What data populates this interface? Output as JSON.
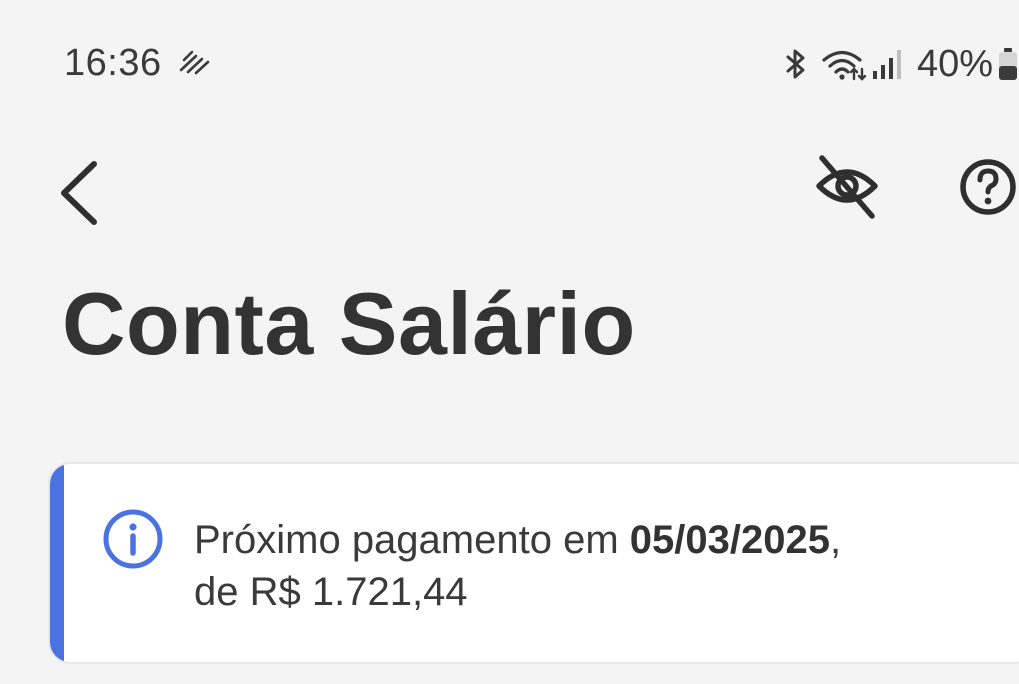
{
  "status_bar": {
    "time": "16:36",
    "battery": "40%",
    "icons": [
      "sync-icon",
      "bluetooth-icon",
      "wifi-icon",
      "signal-icon",
      "battery-icon"
    ]
  },
  "toolbar": {
    "back_icon": "chevron-left-icon",
    "visibility_icon": "eye-off-icon",
    "help_icon": "question-circle-icon"
  },
  "page": {
    "title": "Conta Salário"
  },
  "info_card": {
    "icon": "info-icon",
    "text_prefix": "Próximo pagamento em ",
    "date": "05/03/2025",
    "comma": ",",
    "amount_text": "de R$ 1.721,44",
    "accent_color": "#4a72e0"
  }
}
